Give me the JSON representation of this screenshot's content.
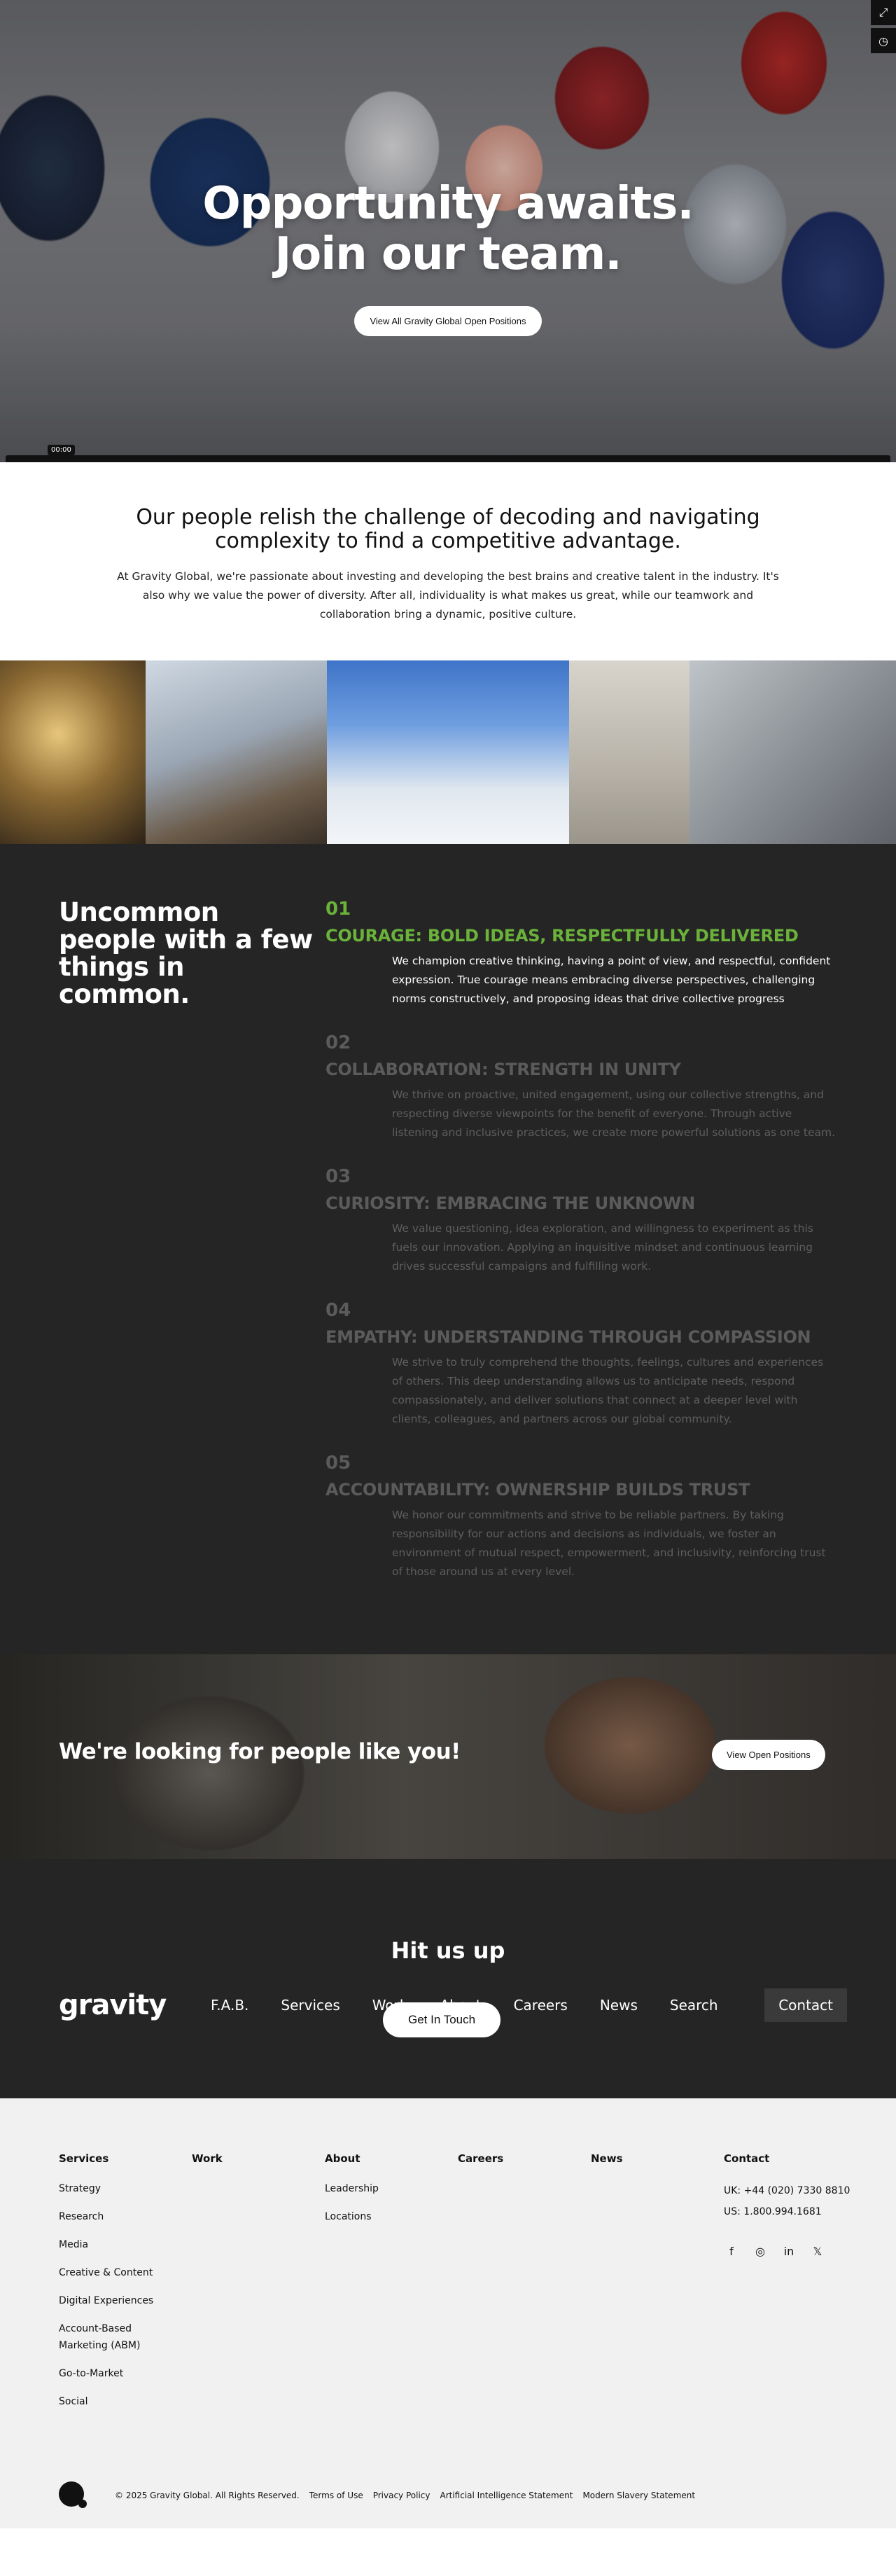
{
  "hero": {
    "title_line1": "Opportunity awaits.",
    "title_line2": "Join our team.",
    "button": "View All Gravity Global Open Positions",
    "video_time": "00:00"
  },
  "intro": {
    "heading": "Our people relish the challenge of decoding and navigating complexity to find a competitive advantage.",
    "body": "At Gravity Global, we're passionate about investing and developing the best brains and creative talent in the industry. It's also why we value the power of diversity. After all, individuality is what makes us great, while our teamwork and collaboration bring a dynamic, positive culture."
  },
  "values": {
    "heading": "Uncommon people with a few things in common.",
    "items": [
      {
        "num": "01",
        "title": "COURAGE: BOLD IDEAS, RESPECTFULLY DELIVERED",
        "text": "We champion creative thinking, having a point of view, and respectful, confident expression. True courage means embracing diverse perspectives, challenging norms constructively, and proposing ideas that drive collective progress"
      },
      {
        "num": "02",
        "title": "COLLABORATION: STRENGTH IN UNITY",
        "text": "We thrive on proactive, united engagement, using our collective strengths, and respecting diverse viewpoints for the benefit of everyone. Through active listening and inclusive practices, we create more powerful solutions as one team."
      },
      {
        "num": "03",
        "title": "CURIOSITY: EMBRACING THE UNKNOWN",
        "text": "We value questioning, idea exploration, and willingness to experiment as this fuels our innovation. Applying an inquisitive mindset and continuous learning drives successful campaigns and fulfilling work."
      },
      {
        "num": "04",
        "title": "EMPATHY: UNDERSTANDING THROUGH COMPASSION",
        "text": "We strive to truly comprehend the thoughts, feelings, cultures and experiences of others. This deep understanding allows us to anticipate needs, respond compassionately, and deliver solutions that connect at a deeper level with clients, colleagues, and partners across our global community."
      },
      {
        "num": "05",
        "title": "ACCOUNTABILITY: OWNERSHIP BUILDS TRUST",
        "text": "We honor our commitments and strive to be reliable partners. By taking responsibility for our actions and decisions as individuals, we foster an environment of mutual respect, empowerment, and inclusivity, reinforcing trust of those around us at every level."
      }
    ]
  },
  "cta": {
    "title": "We're looking for people like you!",
    "button": "View Open Positions"
  },
  "contact": {
    "title": "Hit us up",
    "button": "Get In Touch"
  },
  "nav": {
    "logo": "gravity",
    "items": [
      "F.A.B.",
      "Services",
      "Work",
      "About",
      "Careers",
      "News",
      "Search"
    ],
    "contact": "Contact"
  },
  "footer": {
    "services": {
      "heading": "Services",
      "links": [
        "Strategy",
        "Research",
        "Media",
        "Creative & Content",
        "Digital Experiences",
        "Account-Based Marketing (ABM)",
        "Go-to-Market",
        "Social"
      ]
    },
    "work": {
      "heading": "Work"
    },
    "about": {
      "heading": "About",
      "links": [
        "Leadership",
        "Locations"
      ]
    },
    "careers": {
      "heading": "Careers"
    },
    "news": {
      "heading": "News"
    },
    "contact": {
      "heading": "Contact",
      "uk": "UK: +44 (020) 7330 8810",
      "us": "US: 1.800.994.1681"
    },
    "copyright": "© 2025 Gravity Global. All Rights Reserved.",
    "legal": [
      "Terms of Use",
      "Privacy Policy",
      "Artificial Intelligence Statement",
      "Modern Slavery Statement"
    ]
  }
}
